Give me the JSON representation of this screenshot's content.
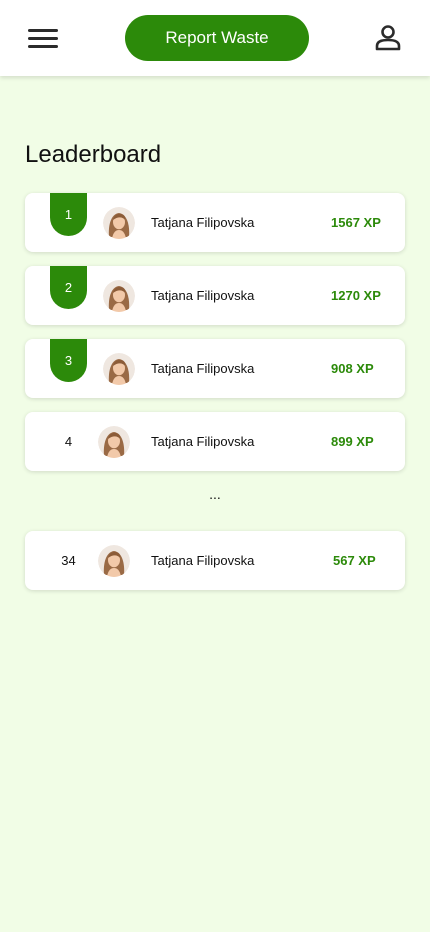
{
  "header": {
    "menu_icon": "hamburger-menu-icon",
    "report_button_label": "Report Waste",
    "profile_icon": "user-profile-icon"
  },
  "page": {
    "title": "Leaderboard",
    "ellipsis": "..."
  },
  "colors": {
    "accent": "#2c8a0a",
    "background": "#f1fde6",
    "card": "#ffffff"
  },
  "leaderboard": [
    {
      "rank": "1",
      "name": "Tatjana Filipovska",
      "xp": "1567 XP",
      "badge": true
    },
    {
      "rank": "2",
      "name": "Tatjana Filipovska",
      "xp": "1270 XP",
      "badge": true
    },
    {
      "rank": "3",
      "name": "Tatjana Filipovska",
      "xp": "908 XP",
      "badge": true
    },
    {
      "rank": "4",
      "name": "Tatjana Filipovska",
      "xp": "899 XP",
      "badge": false
    },
    {
      "rank": "34",
      "name": "Tatjana Filipovska",
      "xp": "567 XP",
      "badge": false
    }
  ]
}
